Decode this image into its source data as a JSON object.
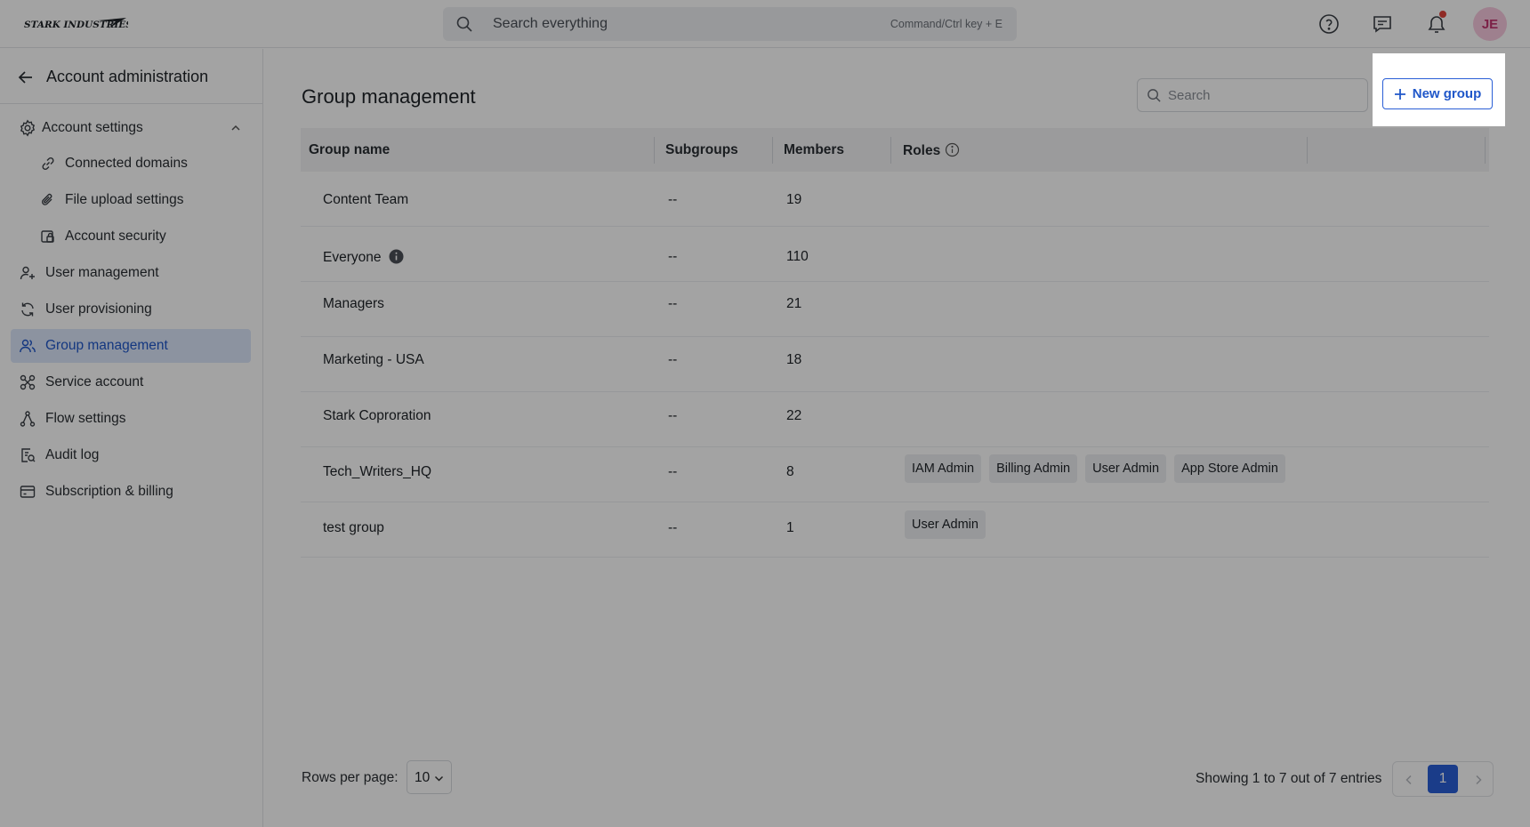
{
  "topbar": {
    "logo_text": "STARK INDUSTRIES",
    "search_placeholder": "Search everything",
    "search_shortcut": "Command/Ctrl key + E",
    "avatar_initials": "JE"
  },
  "sidebar": {
    "title": "Account administration",
    "items": [
      {
        "label": "Account settings"
      },
      {
        "label": "Connected domains"
      },
      {
        "label": "File upload settings"
      },
      {
        "label": "Account security"
      },
      {
        "label": "User management"
      },
      {
        "label": "User provisioning"
      },
      {
        "label": "Group management"
      },
      {
        "label": "Service account"
      },
      {
        "label": "Flow settings"
      },
      {
        "label": "Audit log"
      },
      {
        "label": "Subscription & billing"
      }
    ]
  },
  "main": {
    "title": "Group management",
    "search_placeholder": "Search",
    "new_group_label": "New group",
    "columns": [
      "Group name",
      "Subgroups",
      "Members",
      "Roles"
    ],
    "rows": [
      {
        "name": "Content Team",
        "subgroups": "--",
        "members": "19",
        "roles": []
      },
      {
        "name": "Everyone",
        "subgroups": "--",
        "members": "110",
        "roles": []
      },
      {
        "name": "Managers",
        "subgroups": "--",
        "members": "21",
        "roles": []
      },
      {
        "name": "Marketing - USA",
        "subgroups": "--",
        "members": "18",
        "roles": []
      },
      {
        "name": "Stark Coproration",
        "subgroups": "--",
        "members": "22",
        "roles": []
      },
      {
        "name": "Tech_Writers_HQ",
        "subgroups": "--",
        "members": "8",
        "roles": [
          "IAM Admin",
          "Billing Admin",
          "User Admin",
          "App Store Admin"
        ]
      },
      {
        "name": "test group",
        "subgroups": "--",
        "members": "1",
        "roles": [
          "User Admin"
        ]
      }
    ]
  },
  "footer": {
    "rows_per_page_label": "Rows per page:",
    "rows_per_page_value": "10",
    "showing_text": "Showing 1 to 7 out of 7 entries",
    "current_page": "1"
  },
  "colors": {
    "accent": "#2a5fd6",
    "active_nav_bg": "#dbe6fb",
    "notification": "#e0433b",
    "avatar_bg": "#f8c9de"
  }
}
